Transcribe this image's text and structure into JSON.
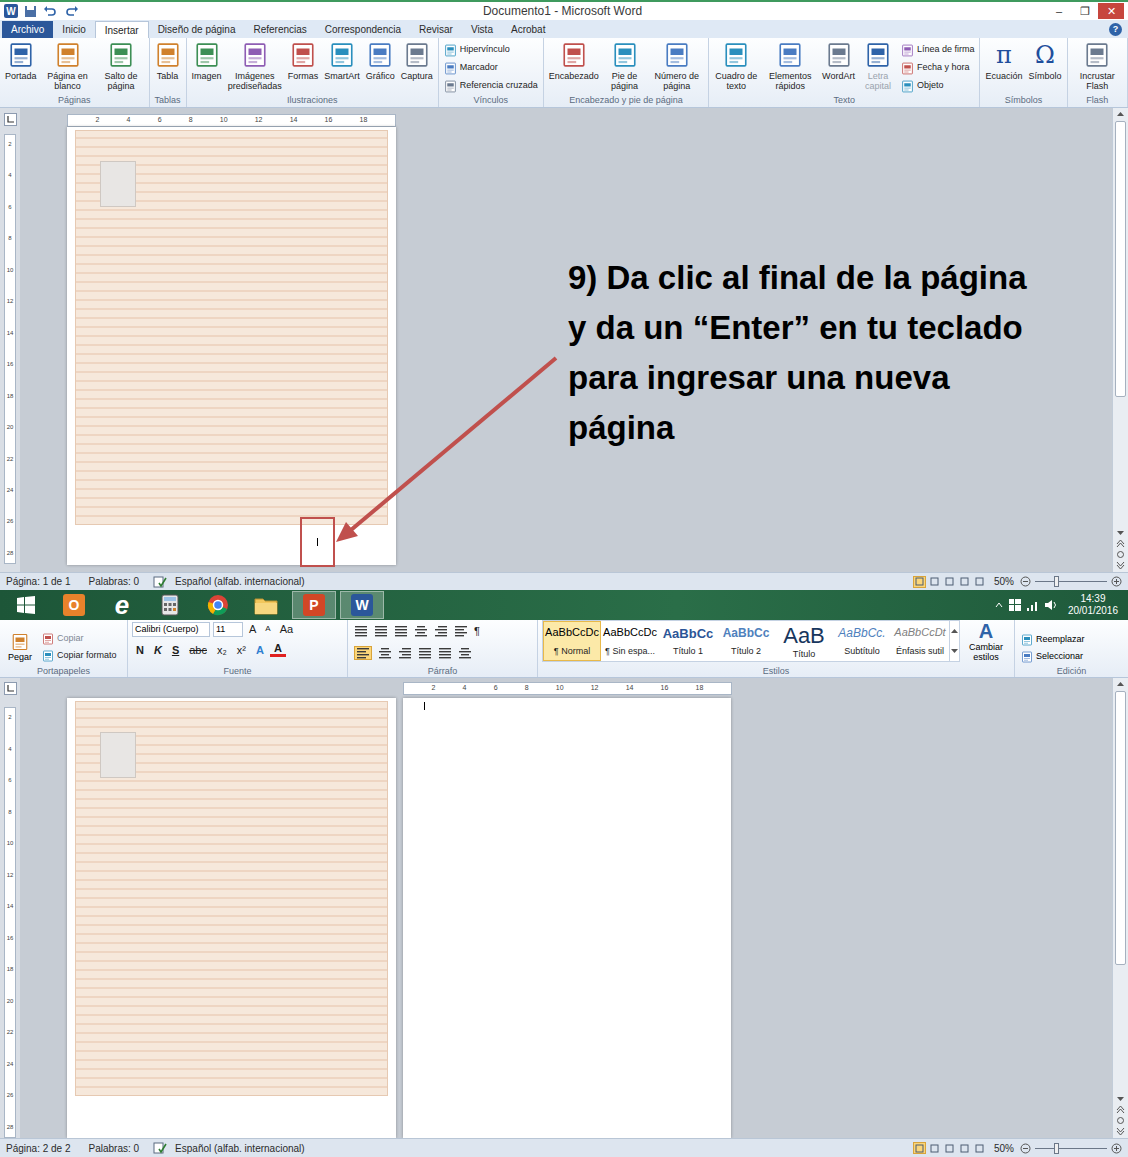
{
  "top_window": {
    "app_icon": "W",
    "title": "Documento1 - Microsoft Word",
    "controls": [
      "–",
      "❐",
      "✕"
    ],
    "help": "?",
    "tabs": [
      {
        "label": "Archivo",
        "selected": false,
        "kind": "file"
      },
      {
        "label": "Inicio",
        "selected": false,
        "kind": "tab"
      },
      {
        "label": "Insertar",
        "selected": true,
        "kind": "tab"
      },
      {
        "label": "Diseño de página",
        "selected": false,
        "kind": "tab"
      },
      {
        "label": "Referencias",
        "selected": false,
        "kind": "tab"
      },
      {
        "label": "Correspondencia",
        "selected": false,
        "kind": "tab"
      },
      {
        "label": "Revisar",
        "selected": false,
        "kind": "tab"
      },
      {
        "label": "Vista",
        "selected": false,
        "kind": "tab"
      },
      {
        "label": "Acrobat",
        "selected": false,
        "kind": "tab"
      }
    ],
    "groups": [
      {
        "label": "Páginas",
        "buttons": [
          {
            "label": "Portada",
            "kind": "large",
            "disabled": false
          },
          {
            "label": "Página en blanco",
            "kind": "large",
            "disabled": false
          },
          {
            "label": "Salto de página",
            "kind": "large",
            "disabled": false
          }
        ]
      },
      {
        "label": "Tablas",
        "buttons": [
          {
            "label": "Tabla",
            "kind": "large",
            "disabled": false
          }
        ]
      },
      {
        "label": "Ilustraciones",
        "buttons": [
          {
            "label": "Imagen",
            "kind": "large",
            "disabled": false
          },
          {
            "label": "Imágenes prediseñadas",
            "kind": "large",
            "disabled": false
          },
          {
            "label": "Formas",
            "kind": "large",
            "disabled": false
          },
          {
            "label": "SmartArt",
            "kind": "large",
            "disabled": false
          },
          {
            "label": "Gráfico",
            "kind": "large",
            "disabled": false
          },
          {
            "label": "Captura",
            "kind": "large",
            "disabled": false
          }
        ]
      },
      {
        "label": "Vínculos",
        "buttons": [
          {
            "label": "Hipervínculo",
            "kind": "small",
            "disabled": false
          },
          {
            "label": "Marcador",
            "kind": "small",
            "disabled": false
          },
          {
            "label": "Referencia cruzada",
            "kind": "small",
            "disabled": false
          }
        ]
      },
      {
        "label": "Encabezado y pie de página",
        "buttons": [
          {
            "label": "Encabezado",
            "kind": "large",
            "disabled": false
          },
          {
            "label": "Pie de página",
            "kind": "large",
            "disabled": false
          },
          {
            "label": "Número de página",
            "kind": "large",
            "disabled": false
          }
        ]
      },
      {
        "label": "Texto",
        "buttons": [
          {
            "label": "Cuadro de texto",
            "kind": "large",
            "disabled": false
          },
          {
            "label": "Elementos rápidos",
            "kind": "large",
            "disabled": false
          },
          {
            "label": "WordArt",
            "kind": "large",
            "disabled": false
          },
          {
            "label": "Letra capital",
            "kind": "large",
            "disabled": true
          },
          {
            "label": "Línea de firma",
            "kind": "small",
            "disabled": false
          },
          {
            "label": "Fecha y hora",
            "kind": "small",
            "disabled": false
          },
          {
            "label": "Objeto",
            "kind": "small",
            "disabled": false
          }
        ]
      },
      {
        "label": "Símbolos",
        "buttons": [
          {
            "label": "Ecuación",
            "kind": "large",
            "disabled": false,
            "glyph": "π"
          },
          {
            "label": "Símbolo",
            "kind": "large",
            "disabled": false,
            "glyph": "Ω"
          }
        ]
      },
      {
        "label": "Flash",
        "buttons": [
          {
            "label": "Incrustar Flash",
            "kind": "large",
            "disabled": false
          }
        ]
      }
    ],
    "ruler": [
      "2",
      "4",
      "6",
      "8",
      "10",
      "12",
      "14",
      "16",
      "18"
    ],
    "vruler": [
      "2",
      "4",
      "6",
      "8",
      "10",
      "12",
      "14",
      "16",
      "18",
      "20",
      "22",
      "24",
      "26",
      "28"
    ],
    "status_bar": {
      "page": "Página: 1 de 1",
      "words": "Palabras: 0",
      "language": "Español (alfab. internacional)",
      "zoom": "50%",
      "zoom_level": 0.27,
      "views": [
        {
          "selected": true
        },
        {
          "selected": false
        },
        {
          "selected": false
        },
        {
          "selected": false
        },
        {
          "selected": false
        }
      ]
    }
  },
  "annotation": "9) Da clic al final de la página  y da un “Enter” en tu teclado para ingresar una nueva página",
  "taskbar": {
    "apps": [
      {
        "kind": "start",
        "selected": false,
        "glyph": ""
      },
      {
        "kind": "outlook",
        "selected": false,
        "glyph": "O"
      },
      {
        "kind": "ie",
        "selected": false,
        "glyph": "e"
      },
      {
        "kind": "calculator",
        "selected": false,
        "glyph": ""
      },
      {
        "kind": "chrome",
        "selected": false,
        "glyph": ""
      },
      {
        "kind": "explorer",
        "selected": false,
        "glyph": ""
      },
      {
        "kind": "powerpoint",
        "selected": true,
        "glyph": "P"
      },
      {
        "kind": "word",
        "selected": true,
        "glyph": "W"
      }
    ],
    "time": "14:39",
    "date": "20/01/2016"
  },
  "bottom_window": {
    "clipboard": {
      "label": "Portapapeles",
      "paste": "Pegar",
      "items": [
        "Copiar",
        "Copiar formato"
      ]
    },
    "font": {
      "label": "Fuente",
      "family": "Calibri (Cuerpo)",
      "size": "11",
      "row1": [
        "A",
        "A",
        "Aa"
      ],
      "row2": [
        {
          "glyph": "N",
          "kind": "bold"
        },
        {
          "glyph": "K",
          "kind": "italic"
        },
        {
          "glyph": "S",
          "kind": "underline"
        },
        {
          "glyph": "abc",
          "kind": "strike"
        },
        {
          "glyph": "x₂",
          "kind": "plain"
        },
        {
          "glyph": "x²",
          "kind": "plain"
        },
        {
          "glyph": "A",
          "kind": "effect"
        },
        {
          "glyph": "A",
          "kind": "color"
        }
      ]
    },
    "paragraph": {
      "label": "Párrafo",
      "pilcrow": "¶"
    },
    "styles": {
      "label": "Estilos",
      "change": "Cambiar estilos",
      "items": [
        {
          "preview": "AaBbCcDc",
          "name": "¶ Normal",
          "kind": "normal",
          "selected": true
        },
        {
          "preview": "AaBbCcDc",
          "name": "¶ Sin espa...",
          "kind": "normal",
          "selected": false
        },
        {
          "preview": "AaBbCc",
          "name": "Título 1",
          "kind": "heading1",
          "selected": false
        },
        {
          "preview": "AaBbCc",
          "name": "Título 2",
          "kind": "heading2",
          "selected": false
        },
        {
          "preview": "AaB",
          "name": "Título",
          "kind": "title",
          "selected": false
        },
        {
          "preview": "AaBbCc.",
          "name": "Subtítulo",
          "kind": "subtitle",
          "selected": false
        },
        {
          "preview": "AaBbCcDt",
          "name": "Énfasis sutil",
          "kind": "emphasis",
          "selected": false
        }
      ]
    },
    "editing": {
      "label": "Edición",
      "items": [
        "Reemplazar",
        "Seleccionar"
      ]
    },
    "ruler": [
      "2",
      "4",
      "6",
      "8",
      "10",
      "12",
      "14",
      "16",
      "18"
    ],
    "vruler": [
      "2",
      "4",
      "6",
      "8",
      "10",
      "12",
      "14",
      "16",
      "18",
      "20",
      "22",
      "24",
      "26",
      "28"
    ],
    "status_bar": {
      "page": "Página: 2 de 2",
      "words": "Palabras: 0",
      "language": "Español (alfab. internacional)",
      "zoom": "50%",
      "zoom_level": 0.27,
      "views": [
        {
          "selected": true
        },
        {
          "selected": false
        },
        {
          "selected": false
        },
        {
          "selected": false
        },
        {
          "selected": false
        }
      ]
    }
  }
}
